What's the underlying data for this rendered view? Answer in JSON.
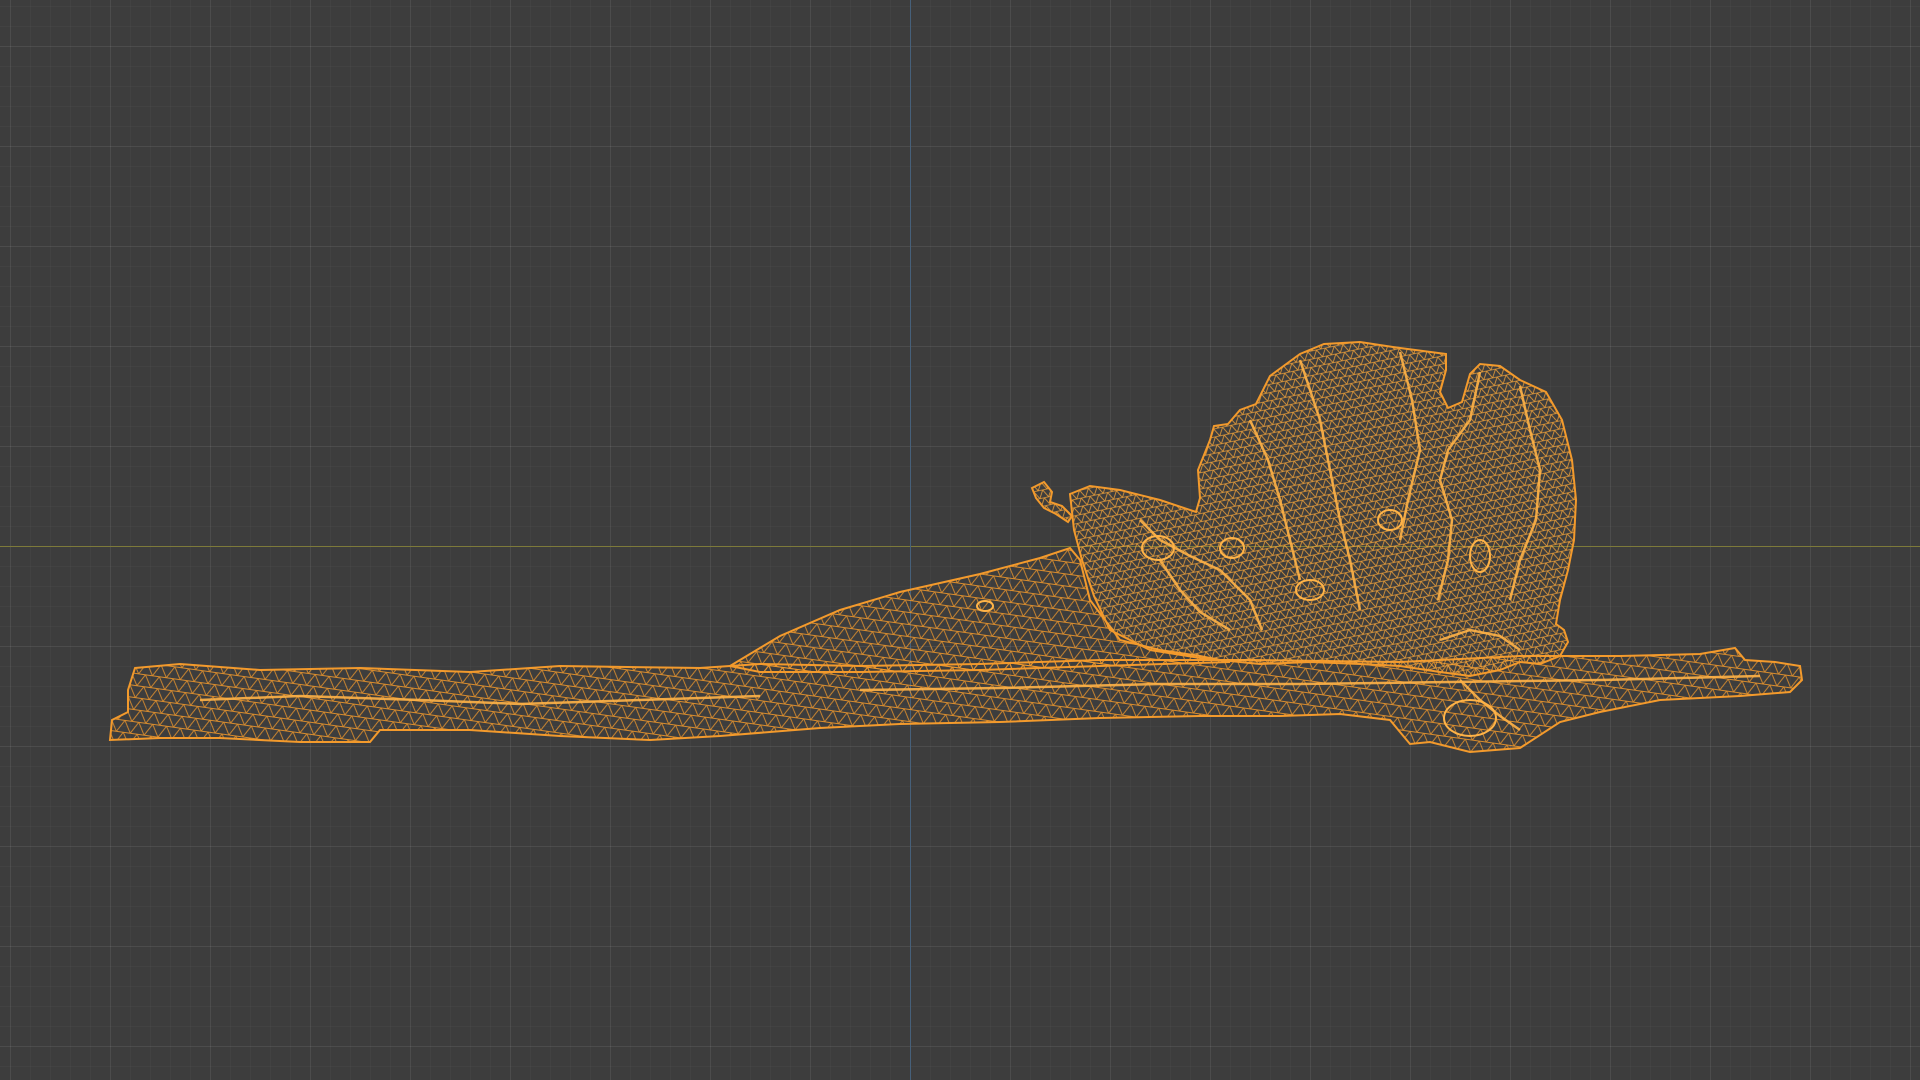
{
  "viewport": {
    "mode": "wireframe",
    "background_color": "#3d3d3d",
    "grid": true
  },
  "axes": {
    "x_axis_color": "#7d7a3a",
    "z_axis_color": "#46607a"
  },
  "object": {
    "display": "wireframe",
    "selected": true,
    "wire_color": "#f39a2c"
  }
}
